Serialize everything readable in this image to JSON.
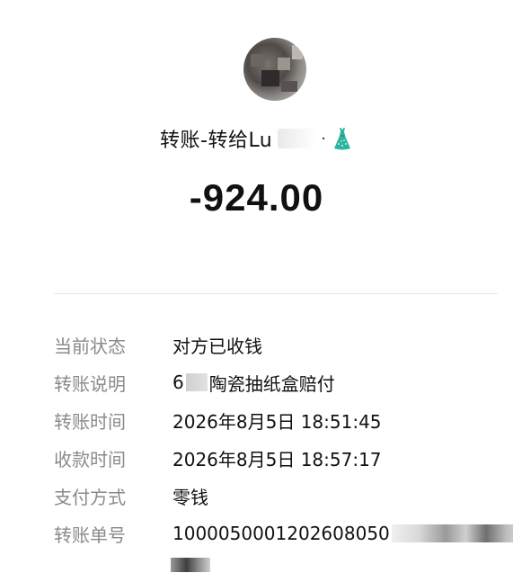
{
  "header": {
    "title_prefix": "转账-转给Lu",
    "title_separator": "·",
    "dress_icon": "dress-icon",
    "avatar_icon": "avatar-icon"
  },
  "amount": "-924.00",
  "details": {
    "status": {
      "label": "当前状态",
      "value": "对方已收钱"
    },
    "note": {
      "label": "转账说明",
      "value_prefix": "6",
      "value_suffix": "陶瓷抽纸盒赔付"
    },
    "transfer_time": {
      "label": "转账时间",
      "value": "2026年8月5日 18:51:45"
    },
    "receive_time": {
      "label": "收款时间",
      "value": "2026年8月5日 18:57:17"
    },
    "payment_method": {
      "label": "支付方式",
      "value": "零钱"
    },
    "transaction_id": {
      "label": "转账单号",
      "value": "1000050001202608050"
    }
  },
  "colors": {
    "label": "#8a8a8a",
    "text": "#111111",
    "divider": "#e8e8e8",
    "dress": "#2bb5a0"
  }
}
